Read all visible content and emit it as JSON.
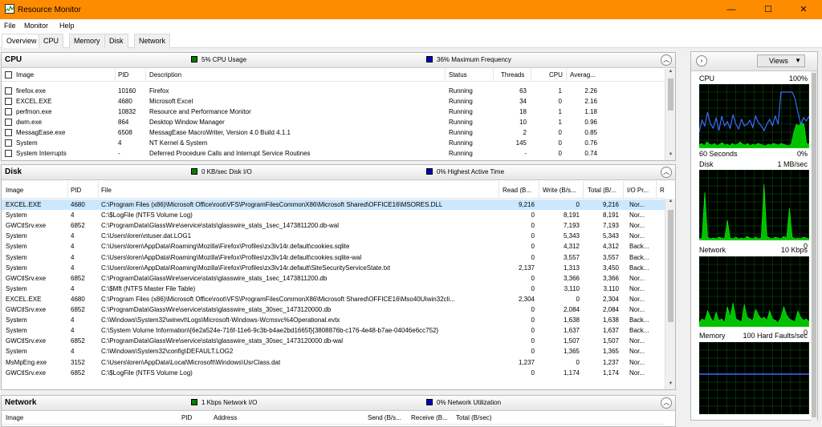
{
  "window": {
    "title": "Resource Monitor",
    "minimize": "—",
    "maximize": "☐",
    "close": "✕"
  },
  "menu": [
    "File",
    "Monitor",
    "Help"
  ],
  "tabs": [
    "Overview",
    "CPU",
    "Memory",
    "Disk",
    "Network"
  ],
  "cpu": {
    "title": "CPU",
    "stat1": "5% CPU Usage",
    "stat2": "36% Maximum Frequency",
    "stat1_color": "#008000",
    "stat2_color": "#0000c0",
    "columns": [
      "Image",
      "PID",
      "Description",
      "Status",
      "Threads",
      "CPU",
      "Averag..."
    ],
    "rows": [
      [
        "firefox.exe",
        "10160",
        "Firefox",
        "Running",
        "63",
        "1",
        "2.26"
      ],
      [
        "EXCEL.EXE",
        "4680",
        "Microsoft Excel",
        "Running",
        "34",
        "0",
        "2.16"
      ],
      [
        "perfmon.exe",
        "10832",
        "Resource and Performance Monitor",
        "Running",
        "18",
        "1",
        "1.18"
      ],
      [
        "dwm.exe",
        "864",
        "Desktop Window Manager",
        "Running",
        "10",
        "1",
        "0.96"
      ],
      [
        "MessagEase.exe",
        "6508",
        "MessagEase MacroWriter, Version 4.0 Build 4.1.1",
        "Running",
        "2",
        "0",
        "0.85"
      ],
      [
        "System",
        "4",
        "NT Kernel & System",
        "Running",
        "145",
        "0",
        "0.76"
      ],
      [
        "System Interrupts",
        "-",
        "Deferred Procedure Calls and Interrupt Service Routines",
        "Running",
        "-",
        "0",
        "0.74"
      ]
    ]
  },
  "disk": {
    "title": "Disk",
    "stat1": "0 KB/sec Disk I/O",
    "stat2": "0% Highest Active Time",
    "columns": [
      "Image",
      "PID",
      "File",
      "Read (B...",
      "Write (B/s...",
      "Total (B/...",
      "I/O Pr...",
      "R"
    ],
    "rows": [
      [
        "EXCEL.EXE",
        "4680",
        "C:\\Program Files (x86)\\Microsoft Office\\root\\VFS\\ProgramFilesCommonX86\\Microsoft Shared\\OFFICE16\\MSORES.DLL",
        "9,216",
        "0",
        "9,216",
        "Nor..."
      ],
      [
        "System",
        "4",
        "C:\\$LogFile (NTFS Volume Log)",
        "0",
        "8,191",
        "8,191",
        "Nor..."
      ],
      [
        "GWCtlSrv.exe",
        "6852",
        "C:\\ProgramData\\GlassWire\\service\\stats\\glasswire_stats_1sec_1473811200.db-wal",
        "0",
        "7,193",
        "7,193",
        "Nor..."
      ],
      [
        "System",
        "4",
        "C:\\Users\\loren\\ntuser.dat.LOG1",
        "0",
        "5,343",
        "5,343",
        "Nor..."
      ],
      [
        "System",
        "4",
        "C:\\Users\\loren\\AppData\\Roaming\\Mozilla\\Firefox\\Profiles\\zx3lv14r.default\\cookies.sqlite",
        "0",
        "4,312",
        "4,312",
        "Back..."
      ],
      [
        "System",
        "4",
        "C:\\Users\\loren\\AppData\\Roaming\\Mozilla\\Firefox\\Profiles\\zx3lv14r.default\\cookies.sqlite-wal",
        "0",
        "3,557",
        "3,557",
        "Back..."
      ],
      [
        "System",
        "4",
        "C:\\Users\\loren\\AppData\\Roaming\\Mozilla\\Firefox\\Profiles\\zx3lv14r.default\\SiteSecurityServiceState.txt",
        "2,137",
        "1,313",
        "3,450",
        "Back..."
      ],
      [
        "GWCtlSrv.exe",
        "6852",
        "C:\\ProgramData\\GlassWire\\service\\stats\\glasswire_stats_1sec_1473811200.db",
        "0",
        "3,366",
        "3,366",
        "Nor..."
      ],
      [
        "System",
        "4",
        "C:\\$Mft (NTFS Master File Table)",
        "0",
        "3,110",
        "3,110",
        "Nor..."
      ],
      [
        "EXCEL.EXE",
        "4680",
        "C:\\Program Files (x86)\\Microsoft Office\\root\\VFS\\ProgramFilesCommonX86\\Microsoft Shared\\OFFICE16\\Mso40UIwin32cli...",
        "2,304",
        "0",
        "2,304",
        "Nor..."
      ],
      [
        "GWCtlSrv.exe",
        "6852",
        "C:\\ProgramData\\GlassWire\\service\\stats\\glasswire_stats_30sec_1473120000.db",
        "0",
        "2,084",
        "2,084",
        "Nor..."
      ],
      [
        "System",
        "4",
        "C:\\Windows\\System32\\winevt\\Logs\\Microsoft-Windows-Wcmsvc%4Operational.evtx",
        "0",
        "1,638",
        "1,638",
        "Back..."
      ],
      [
        "System",
        "4",
        "C:\\System Volume Information\\{6e2a524e-716f-11e6-9c3b-b4ae2bd1665f}{3808876b-c176-4e48-b7ae-04046e6cc752}",
        "0",
        "1,637",
        "1,637",
        "Back..."
      ],
      [
        "GWCtlSrv.exe",
        "6852",
        "C:\\ProgramData\\GlassWire\\service\\stats\\glasswire_stats_30sec_1473120000.db-wal",
        "0",
        "1,507",
        "1,507",
        "Nor..."
      ],
      [
        "System",
        "4",
        "C:\\Windows\\System32\\config\\DEFAULT.LOG2",
        "0",
        "1,365",
        "1,365",
        "Nor..."
      ],
      [
        "MsMpEng.exe",
        "3152",
        "C:\\Users\\loren\\AppData\\Local\\Microsoft\\Windows\\UsrClass.dat",
        "1,237",
        "0",
        "1,237",
        "Nor..."
      ],
      [
        "GWCtlSrv.exe",
        "6852",
        "C:\\$LogFile (NTFS Volume Log)",
        "0",
        "1,174",
        "1,174",
        "Nor..."
      ]
    ]
  },
  "network": {
    "title": "Network",
    "stat1": "1 Kbps Network I/O",
    "stat2": "0% Network Utilization",
    "columns": [
      "Image",
      "PID",
      "Address",
      "Send (B/s...",
      "Receive (B...",
      "Total (B/sec)"
    ]
  },
  "rightpane": {
    "views_label": "Views",
    "graphs": [
      {
        "name": "CPU",
        "right": "100%",
        "bottom_left": "60 Seconds",
        "bottom_right": "0%"
      },
      {
        "name": "Disk",
        "right": "1 MB/sec",
        "bottom_left": "",
        "bottom_right": "0"
      },
      {
        "name": "Network",
        "right": "10 Kbps",
        "bottom_left": "",
        "bottom_right": "0"
      },
      {
        "name": "Memory",
        "right": "100 Hard Faults/sec",
        "bottom_left": "",
        "bottom_right": ""
      }
    ]
  }
}
